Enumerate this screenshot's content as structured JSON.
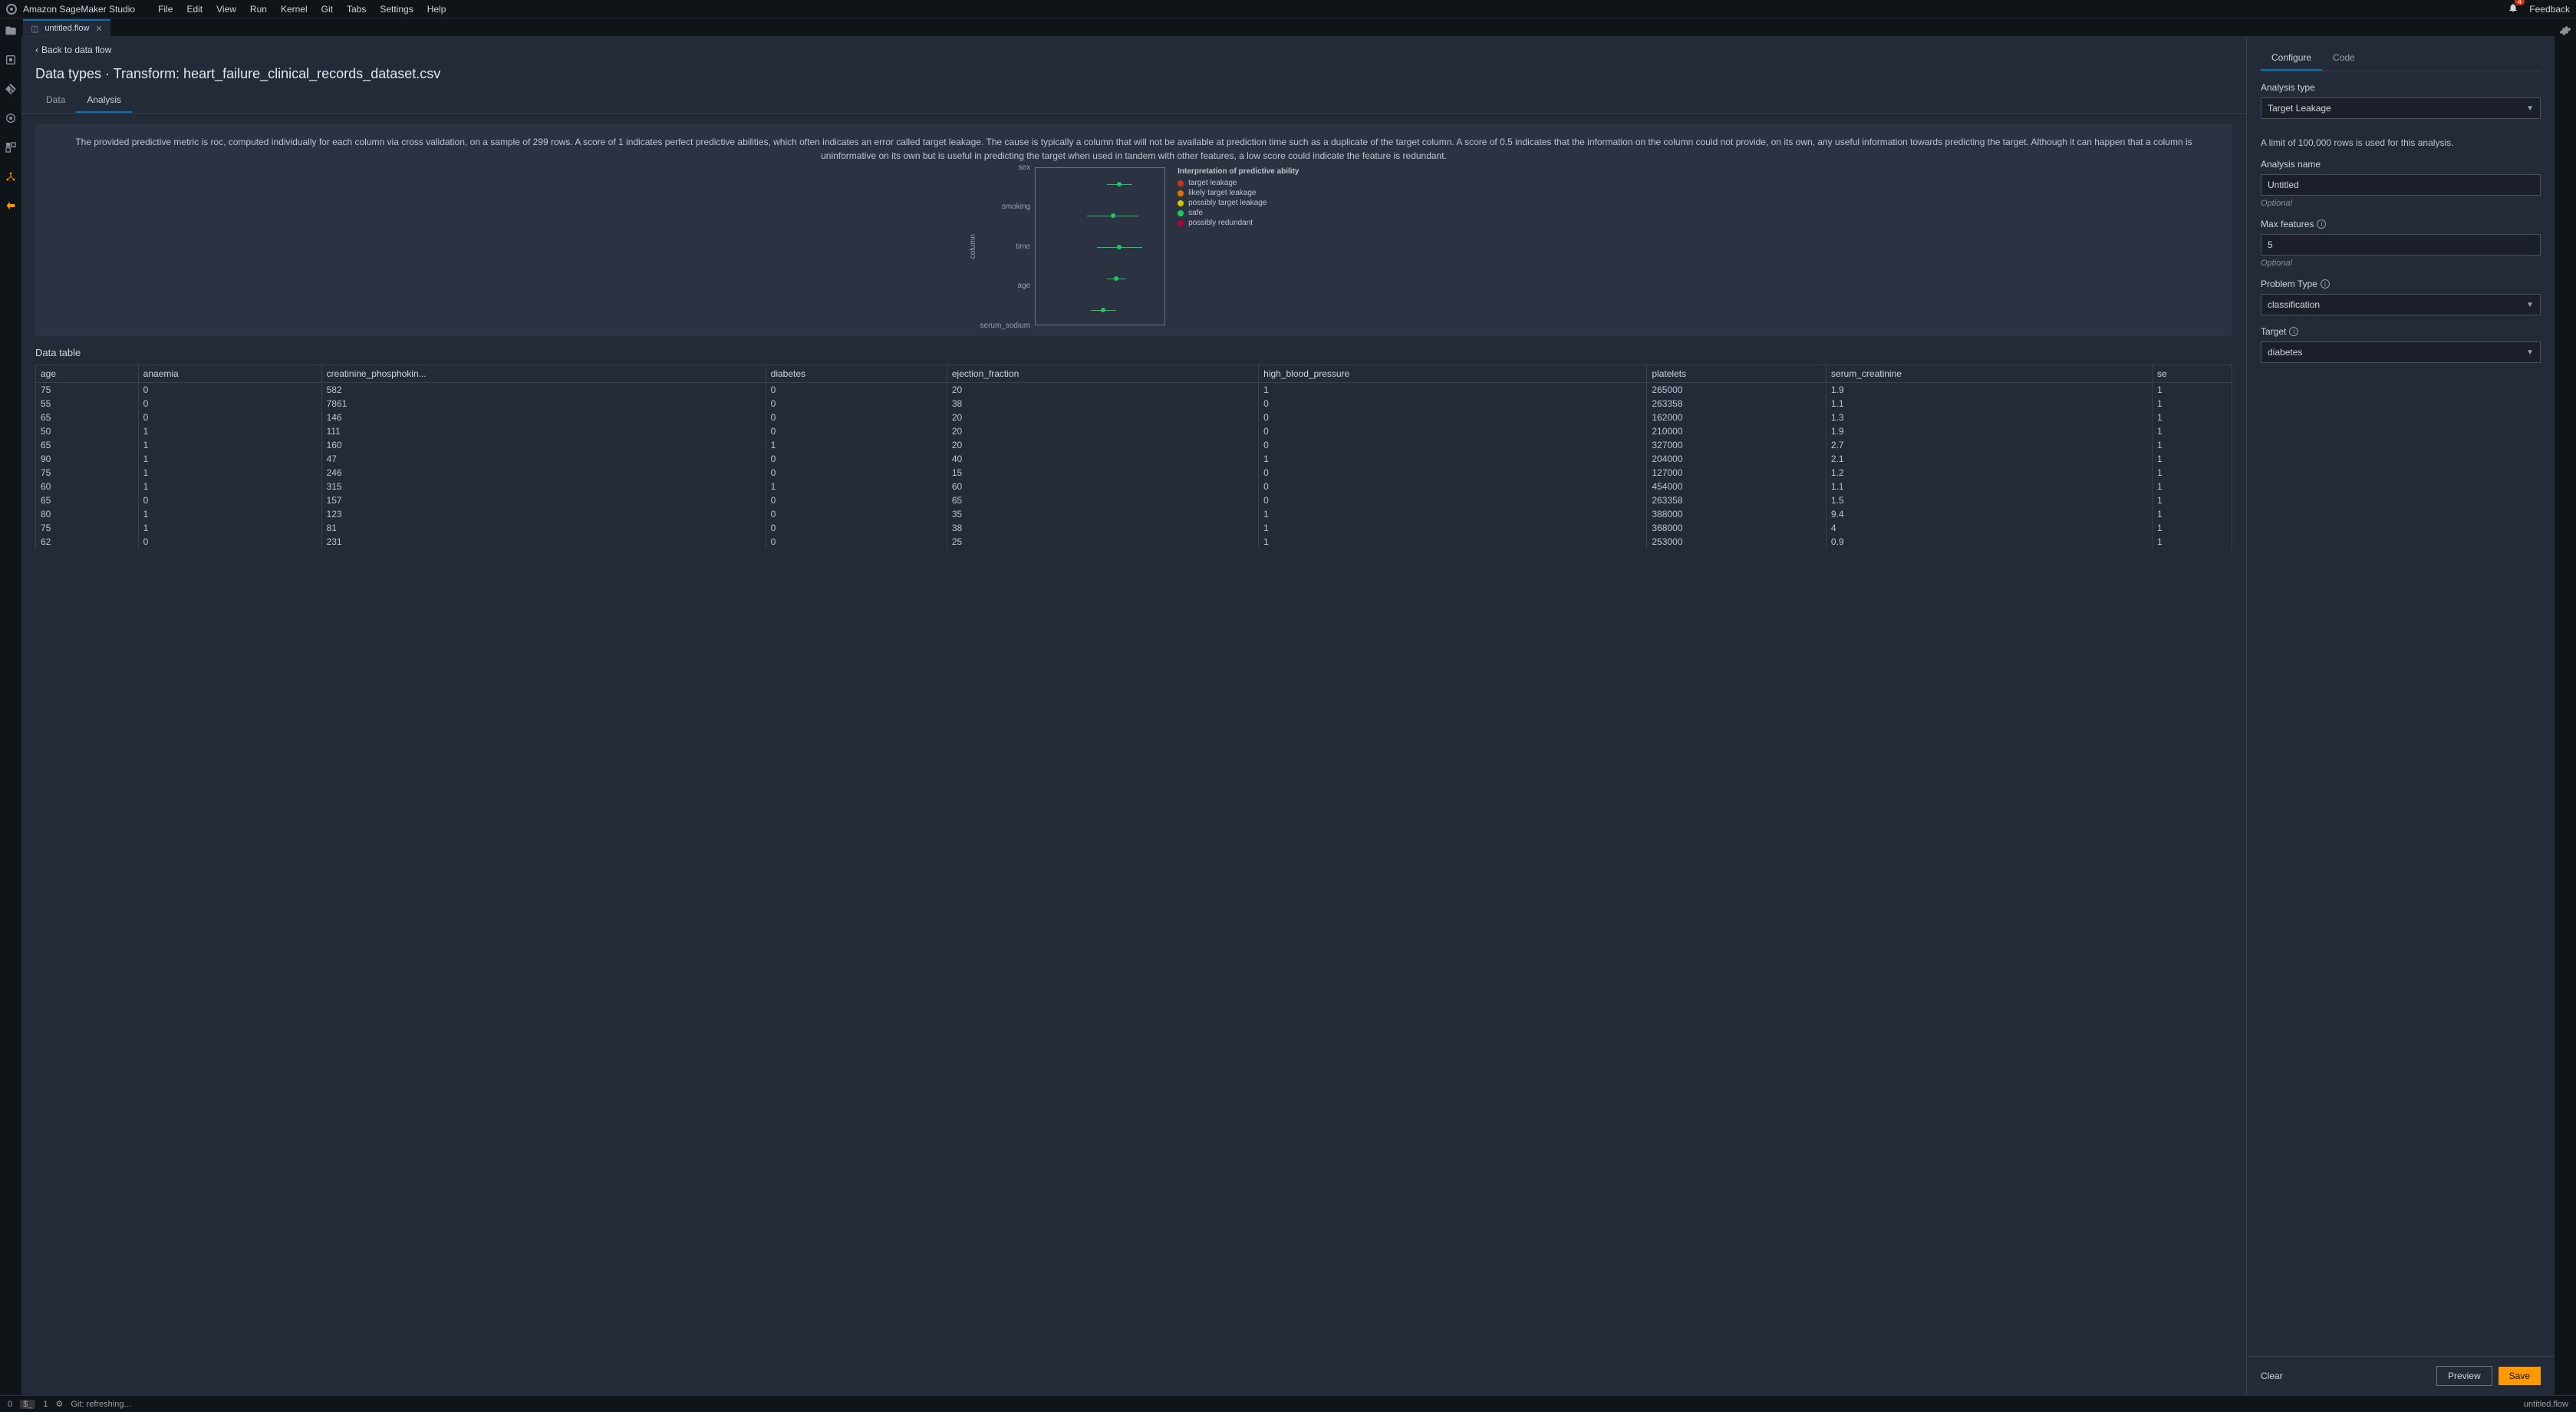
{
  "topbar": {
    "app_title": "Amazon SageMaker Studio",
    "menu": [
      "File",
      "Edit",
      "View",
      "Run",
      "Kernel",
      "Git",
      "Tabs",
      "Settings",
      "Help"
    ],
    "badge": "4",
    "feedback": "Feedback"
  },
  "tab": {
    "label": "untitled.flow"
  },
  "back_link": "Back to data flow",
  "page_title": "Data types · Transform: heart_failure_clinical_records_dataset.csv",
  "subtabs": {
    "data": "Data",
    "analysis": "Analysis"
  },
  "analysis_desc": "The provided predictive metric is roc, computed individually for each column via cross validation, on a sample of 299 rows. A score of 1 indicates perfect predictive abilities, which often indicates an error called target leakage. The cause is typically a column that will not be available at prediction time such as a duplicate of the target column. A score of 0.5 indicates that the information on the column could not provide, on its own, any useful information towards predicting the target. Although it can happen that a column is uninformative on its own but is useful in predicting the target when used in tandem with other features, a low score could indicate the feature is redundant.",
  "chart_data": {
    "type": "scatter",
    "ylabel": "column",
    "title": "Interpretation of predictive ability",
    "xrange": [
      0.3,
      0.7
    ],
    "categories": [
      "sex",
      "smoking",
      "time",
      "age",
      "serum_sodium"
    ],
    "points": [
      {
        "cat": "sex",
        "x": 0.56,
        "err": 0.04,
        "class": "safe"
      },
      {
        "cat": "smoking",
        "x": 0.54,
        "err": 0.08,
        "class": "safe"
      },
      {
        "cat": "time",
        "x": 0.56,
        "err": 0.07,
        "class": "safe"
      },
      {
        "cat": "age",
        "x": 0.55,
        "err": 0.03,
        "class": "safe"
      },
      {
        "cat": "serum_sodium",
        "x": 0.51,
        "err": 0.04,
        "class": "safe"
      }
    ],
    "legend": [
      {
        "label": "target leakage",
        "color": "#d13212"
      },
      {
        "label": "likely target leakage",
        "color": "#e07000"
      },
      {
        "label": "possibly target leakage",
        "color": "#d4c400"
      },
      {
        "label": "safe",
        "color": "#22c55e"
      },
      {
        "label": "possibly redundant",
        "color": "#b00040"
      }
    ]
  },
  "table_title": "Data table",
  "table": {
    "columns": [
      "age",
      "anaemia",
      "creatinine_phosphokin...",
      "diabetes",
      "ejection_fraction",
      "high_blood_pressure",
      "platelets",
      "serum_creatinine",
      "se"
    ],
    "rows": [
      [
        "75",
        "0",
        "582",
        "0",
        "20",
        "1",
        "265000",
        "1.9",
        "1"
      ],
      [
        "55",
        "0",
        "7861",
        "0",
        "38",
        "0",
        "263358",
        "1.1",
        "1"
      ],
      [
        "65",
        "0",
        "146",
        "0",
        "20",
        "0",
        "162000",
        "1.3",
        "1"
      ],
      [
        "50",
        "1",
        "111",
        "0",
        "20",
        "0",
        "210000",
        "1.9",
        "1"
      ],
      [
        "65",
        "1",
        "160",
        "1",
        "20",
        "0",
        "327000",
        "2.7",
        "1"
      ],
      [
        "90",
        "1",
        "47",
        "0",
        "40",
        "1",
        "204000",
        "2.1",
        "1"
      ],
      [
        "75",
        "1",
        "246",
        "0",
        "15",
        "0",
        "127000",
        "1.2",
        "1"
      ],
      [
        "60",
        "1",
        "315",
        "1",
        "60",
        "0",
        "454000",
        "1.1",
        "1"
      ],
      [
        "65",
        "0",
        "157",
        "0",
        "65",
        "0",
        "263358",
        "1.5",
        "1"
      ],
      [
        "80",
        "1",
        "123",
        "0",
        "35",
        "1",
        "388000",
        "9.4",
        "1"
      ],
      [
        "75",
        "1",
        "81",
        "0",
        "38",
        "1",
        "368000",
        "4",
        "1"
      ],
      [
        "62",
        "0",
        "231",
        "0",
        "25",
        "1",
        "253000",
        "0.9",
        "1"
      ]
    ]
  },
  "right": {
    "tabs": {
      "configure": "Configure",
      "code": "Code"
    },
    "analysis_type_label": "Analysis type",
    "analysis_type_value": "Target Leakage",
    "row_limit_note": "A limit of 100,000 rows is used for this analysis.",
    "analysis_name_label": "Analysis name",
    "analysis_name_value": "Untitled",
    "optional": "Optional",
    "max_features_label": "Max features",
    "max_features_value": "5",
    "problem_type_label": "Problem Type",
    "problem_type_value": "classification",
    "target_label": "Target",
    "target_value": "diabetes",
    "clear": "Clear",
    "preview": "Preview",
    "save": "Save"
  },
  "statusbar": {
    "zero": "0",
    "term": "1",
    "git": "Git: refreshing...",
    "file": "untitled.flow"
  }
}
